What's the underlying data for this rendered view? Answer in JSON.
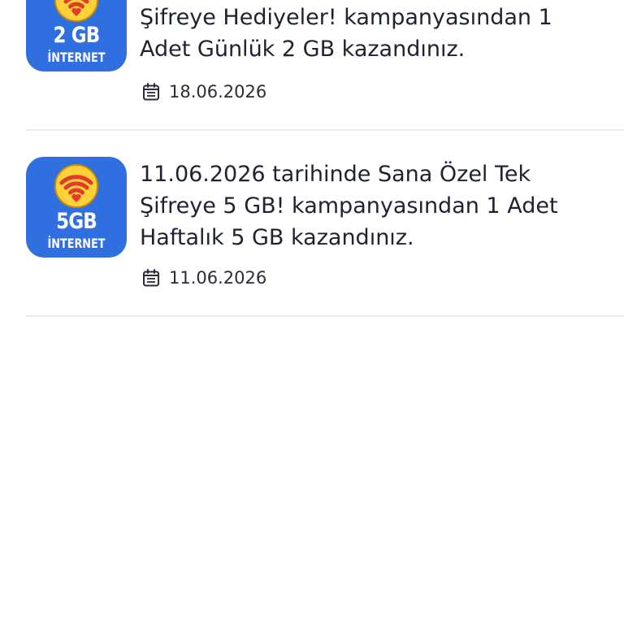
{
  "campaigns": [
    {
      "badge_size": "2 GB",
      "badge_label": "İNTERNET",
      "text": "Şifreye Hediyeler! kampanyasından 1\nAdet Günlük 2 GB kazandınız.",
      "date": "18.06.2026",
      "badge_icon": "wifi-heart-icon",
      "date_icon": "calendar-icon"
    },
    {
      "badge_size": "5GB",
      "badge_label": "İNTERNET",
      "text": " 11.06.2026 tarihinde Sana Özel Tek\nŞifreye 5 GB! kampanyasından 1 Adet\nHaftalık 5 GB kazandınız.",
      "date": "11.06.2026",
      "badge_icon": "wifi-heart-icon",
      "date_icon": "calendar-icon"
    }
  ],
  "colors": {
    "badge_bg": "#2f6fe0",
    "wifi_circle": "#ffd23a",
    "wifi_arcs": "#e23b2b",
    "text": "#1f2230",
    "divider": "#e9eaee"
  }
}
